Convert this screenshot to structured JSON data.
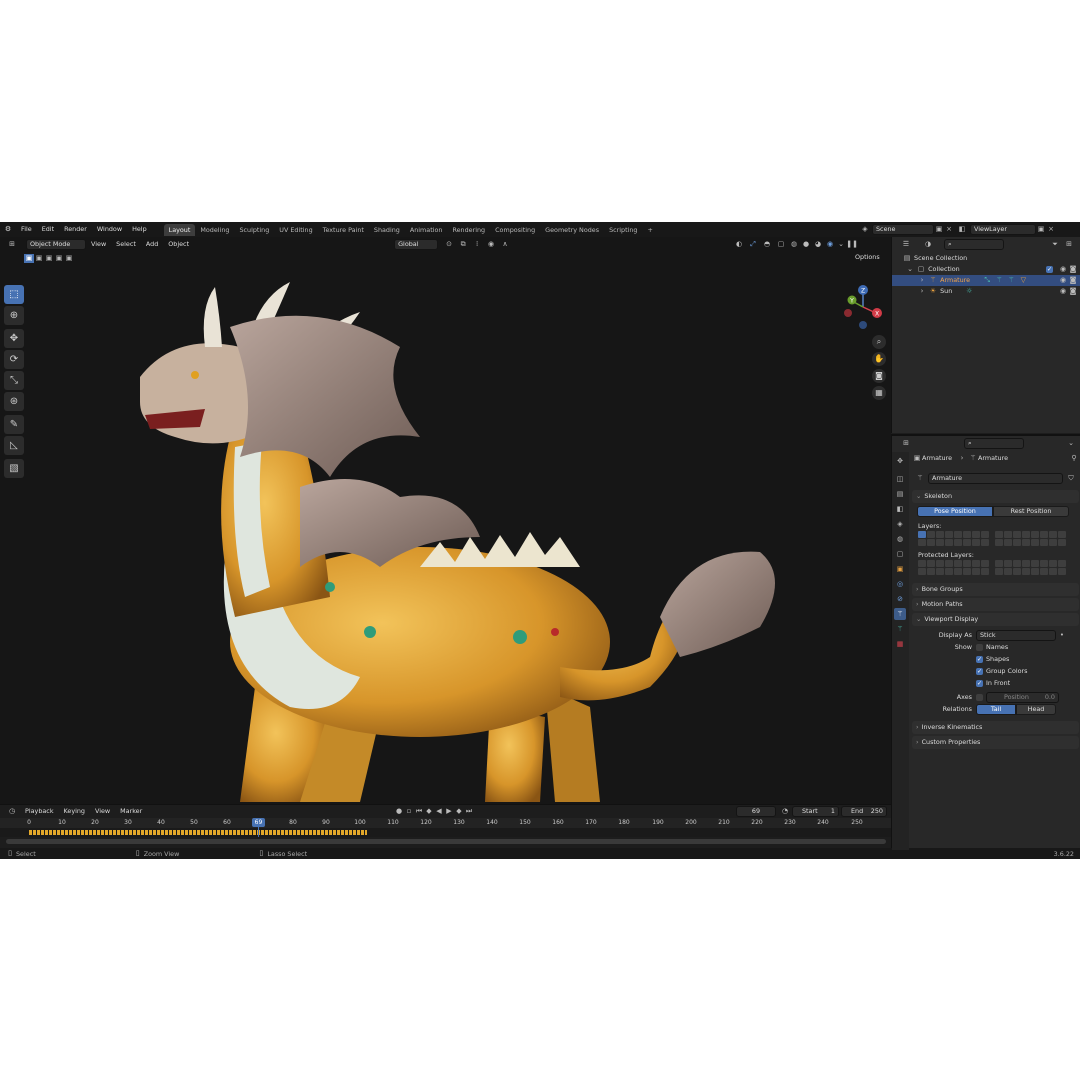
{
  "topbar": {
    "menus": [
      "File",
      "Edit",
      "Render",
      "Window",
      "Help"
    ],
    "workspaces": [
      "Layout",
      "Modeling",
      "Sculpting",
      "UV Editing",
      "Texture Paint",
      "Shading",
      "Animation",
      "Rendering",
      "Compositing",
      "Geometry Nodes",
      "Scripting"
    ],
    "active_workspace": "Layout",
    "add_tab": "+",
    "scene": "Scene",
    "view_layer": "ViewLayer"
  },
  "viewport": {
    "mode": "Object Mode",
    "menus": [
      "View",
      "Select",
      "Add",
      "Object"
    ],
    "transform_orientation": "Global",
    "options": "Options",
    "gizmo_axes": [
      "Z",
      "Y",
      "X"
    ]
  },
  "timeline": {
    "menus": [
      "Playback",
      "Keying",
      "View",
      "Marker"
    ],
    "current_frame": "69",
    "start_label": "Start",
    "start": "1",
    "end_label": "End",
    "end": "250",
    "ticks": [
      "0",
      "10",
      "20",
      "30",
      "40",
      "50",
      "60",
      "80",
      "90",
      "100",
      "110",
      "120",
      "130",
      "140",
      "150",
      "160",
      "170",
      "180",
      "190",
      "200",
      "210",
      "220",
      "230",
      "240",
      "250"
    ],
    "playhead": "69"
  },
  "statusbar": {
    "left": "Select",
    "middle": "Zoom View",
    "right": "Lasso Select",
    "version": "3.6.22"
  },
  "outliner": {
    "scene_collection": "Scene Collection",
    "collection": "Collection",
    "armature": "Armature",
    "sun": "Sun"
  },
  "properties": {
    "breadcrumb_object": "Armature",
    "breadcrumb_data": "Armature",
    "data_name": "Armature",
    "skeleton": "Skeleton",
    "pose_position": "Pose Position",
    "rest_position": "Rest Position",
    "layers": "Layers:",
    "protected_layers": "Protected Layers:",
    "bone_groups": "Bone Groups",
    "motion_paths": "Motion Paths",
    "viewport_display": "Viewport Display",
    "display_as_label": "Display As",
    "display_as": "Stick",
    "show_label": "Show",
    "names": "Names",
    "shapes": "Shapes",
    "group_colors": "Group Colors",
    "in_front": "In Front",
    "axes_label": "Axes",
    "position_label": "Position",
    "position_value": "0.0",
    "relations_label": "Relations",
    "tail": "Tail",
    "head": "Head",
    "inverse_kinematics": "Inverse Kinematics",
    "custom_properties": "Custom Properties"
  },
  "colors": {
    "accent": "#4772b3",
    "background": "#1d1d1d",
    "panel": "#282828"
  }
}
